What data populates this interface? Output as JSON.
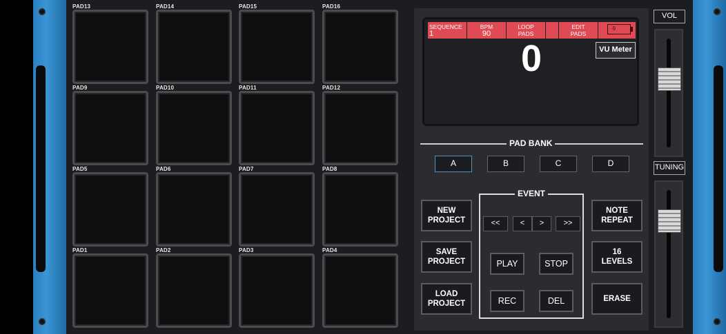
{
  "pads": [
    {
      "label": "PAD13"
    },
    {
      "label": "PAD14"
    },
    {
      "label": "PAD15"
    },
    {
      "label": "PAD16"
    },
    {
      "label": "PAD9"
    },
    {
      "label": "PAD10"
    },
    {
      "label": "PAD11"
    },
    {
      "label": "PAD12"
    },
    {
      "label": "PAD5"
    },
    {
      "label": "PAD6"
    },
    {
      "label": "PAD7"
    },
    {
      "label": "PAD8"
    },
    {
      "label": "PAD1"
    },
    {
      "label": "PAD2"
    },
    {
      "label": "PAD3"
    },
    {
      "label": "PAD4"
    }
  ],
  "screen": {
    "tabs": [
      {
        "label": "SEQUENCE",
        "value": "1"
      },
      {
        "label": "BPM",
        "value": "90"
      },
      {
        "label": "LOOP",
        "value": "PADS"
      },
      {
        "label": "EDIT",
        "value": "PADS"
      }
    ],
    "battery": "-9",
    "big_number": "0",
    "vu_meter": "VU Meter"
  },
  "pad_bank": {
    "title": "PAD BANK",
    "banks": [
      "A",
      "B",
      "C",
      "D"
    ],
    "active": "A"
  },
  "left_buttons": [
    "NEW\nPROJECT",
    "SAVE\nPROJECT",
    "LOAD\nPROJECT"
  ],
  "event": {
    "title": "EVENT",
    "nav": [
      "<<",
      "<",
      ">",
      ">>"
    ],
    "play": "PLAY",
    "stop": "STOP",
    "rec": "REC",
    "del": "DEL"
  },
  "right_buttons": [
    "NOTE\nREPEAT",
    "16\nLEVELS",
    "ERASE"
  ],
  "faders": {
    "vol_label": "VOL",
    "vol_level": 0.65,
    "tuning_label": "TUNING",
    "tuning_level": 0.8
  },
  "colors": {
    "rack_blue": "#2a7fbf",
    "screen_red": "#e04a55",
    "active_bank_border": "#5a8fc4"
  }
}
